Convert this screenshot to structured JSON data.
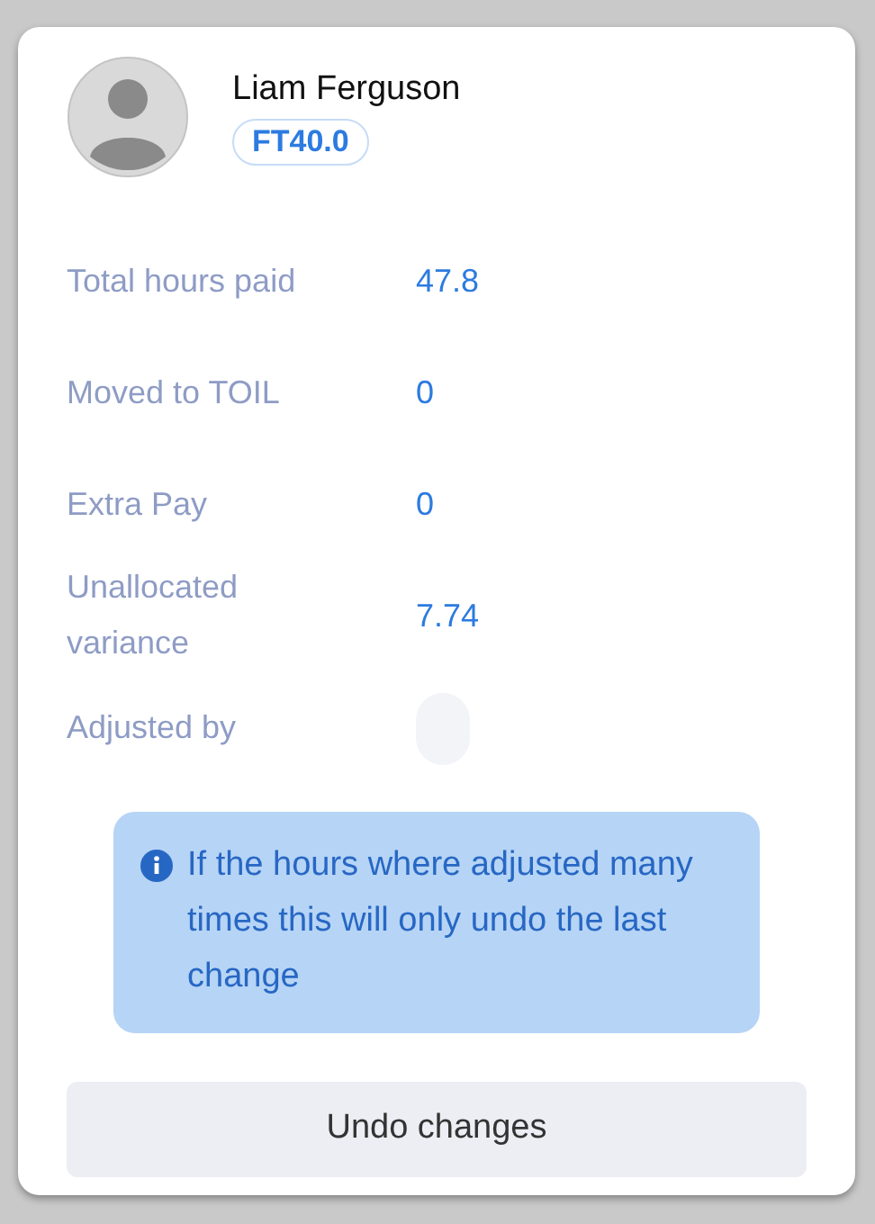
{
  "employee": {
    "name": "Liam Ferguson",
    "contract_badge": "FT40.0"
  },
  "fields": [
    {
      "kind": "value",
      "label": "Total hours paid",
      "value": "47.8"
    },
    {
      "kind": "value",
      "label": "Moved to TOIL",
      "value": "0"
    },
    {
      "kind": "value",
      "label": "Extra Pay",
      "value": "0"
    },
    {
      "kind": "value",
      "label": "Unallocated variance",
      "value": "7.74"
    },
    {
      "kind": "avatar",
      "label": "Adjusted by"
    }
  ],
  "notice": "If the hours where adjusted many times this will only undo the last change",
  "buttons": [
    "Undo changes"
  ]
}
